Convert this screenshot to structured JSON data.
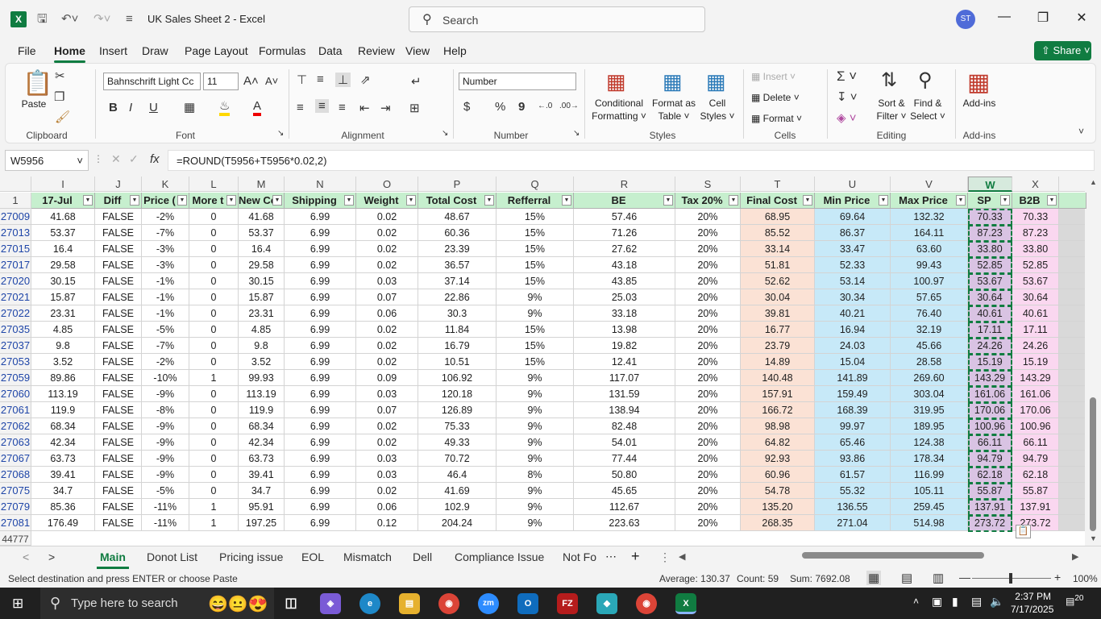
{
  "window": {
    "title": "UK Sales Sheet 2  -  Excel",
    "app_icon": "X",
    "avatar": "ST",
    "search_placeholder": "Search"
  },
  "menu": {
    "items": [
      "File",
      "Home",
      "Insert",
      "Draw",
      "Page Layout",
      "Formulas",
      "Data",
      "Review",
      "View",
      "Help"
    ],
    "active": "Home",
    "share": "Share"
  },
  "ribbon": {
    "clipboard": {
      "paste": "Paste",
      "label": "Clipboard"
    },
    "font": {
      "name": "Bahnschrift Light Cc",
      "size": "11",
      "bold": "B",
      "italic": "I",
      "underline": "U",
      "label": "Font"
    },
    "alignment": {
      "label": "Alignment"
    },
    "number": {
      "format": "Number",
      "currency": "$",
      "percent": "%",
      "comma": "9",
      "label": "Number"
    },
    "styles": {
      "conditional": "Conditional",
      "conditional2": "Formatting",
      "format_table": "Format as",
      "format_table2": "Table",
      "cell_styles": "Cell",
      "cell_styles2": "Styles",
      "label": "Styles"
    },
    "cells": {
      "insert": "Insert",
      "delete": "Delete",
      "format": "Format",
      "label": "Cells"
    },
    "editing": {
      "sort": "Sort &",
      "sort2": "Filter",
      "find": "Find &",
      "find2": "Select",
      "label": "Editing"
    },
    "addins": {
      "addins": "Add-ins",
      "label": "Add-ins"
    }
  },
  "formula_bar": {
    "name_box": "W5956",
    "fx": "fx",
    "formula": "=ROUND(T5956+T5956*0.02,2)"
  },
  "columns": [
    "I",
    "J",
    "K",
    "L",
    "M",
    "N",
    "O",
    "P",
    "Q",
    "R",
    "S",
    "T",
    "U",
    "V",
    "W",
    "X"
  ],
  "headers": [
    "17-Jul",
    "Diff",
    "Price (",
    "More t",
    "New Cc",
    "Shipping",
    "Weight",
    "Total Cost",
    "Refferral",
    "BE",
    "Tax 20%",
    "Final Cost",
    "Min Price",
    "Max Price",
    "SP",
    "B2B"
  ],
  "row1_label": "1",
  "rows": [
    {
      "r": "27009",
      "v": [
        "41.68",
        "FALSE",
        "-2%",
        "0",
        "41.68",
        "6.99",
        "0.02",
        "48.67",
        "15%",
        "57.46",
        "20%",
        "68.95",
        "69.64",
        "132.32",
        "70.33",
        "70.33"
      ]
    },
    {
      "r": "27013",
      "v": [
        "53.37",
        "FALSE",
        "-7%",
        "0",
        "53.37",
        "6.99",
        "0.02",
        "60.36",
        "15%",
        "71.26",
        "20%",
        "85.52",
        "86.37",
        "164.11",
        "87.23",
        "87.23"
      ]
    },
    {
      "r": "27015",
      "v": [
        "16.4",
        "FALSE",
        "-3%",
        "0",
        "16.4",
        "6.99",
        "0.02",
        "23.39",
        "15%",
        "27.62",
        "20%",
        "33.14",
        "33.47",
        "63.60",
        "33.80",
        "33.80"
      ]
    },
    {
      "r": "27017",
      "v": [
        "29.58",
        "FALSE",
        "-3%",
        "0",
        "29.58",
        "6.99",
        "0.02",
        "36.57",
        "15%",
        "43.18",
        "20%",
        "51.81",
        "52.33",
        "99.43",
        "52.85",
        "52.85"
      ]
    },
    {
      "r": "27020",
      "v": [
        "30.15",
        "FALSE",
        "-1%",
        "0",
        "30.15",
        "6.99",
        "0.03",
        "37.14",
        "15%",
        "43.85",
        "20%",
        "52.62",
        "53.14",
        "100.97",
        "53.67",
        "53.67"
      ]
    },
    {
      "r": "27021",
      "v": [
        "15.87",
        "FALSE",
        "-1%",
        "0",
        "15.87",
        "6.99",
        "0.07",
        "22.86",
        "9%",
        "25.03",
        "20%",
        "30.04",
        "30.34",
        "57.65",
        "30.64",
        "30.64"
      ]
    },
    {
      "r": "27022",
      "v": [
        "23.31",
        "FALSE",
        "-1%",
        "0",
        "23.31",
        "6.99",
        "0.06",
        "30.3",
        "9%",
        "33.18",
        "20%",
        "39.81",
        "40.21",
        "76.40",
        "40.61",
        "40.61"
      ]
    },
    {
      "r": "27035",
      "v": [
        "4.85",
        "FALSE",
        "-5%",
        "0",
        "4.85",
        "6.99",
        "0.02",
        "11.84",
        "15%",
        "13.98",
        "20%",
        "16.77",
        "16.94",
        "32.19",
        "17.11",
        "17.11"
      ]
    },
    {
      "r": "27037",
      "v": [
        "9.8",
        "FALSE",
        "-7%",
        "0",
        "9.8",
        "6.99",
        "0.02",
        "16.79",
        "15%",
        "19.82",
        "20%",
        "23.79",
        "24.03",
        "45.66",
        "24.26",
        "24.26"
      ]
    },
    {
      "r": "27053",
      "v": [
        "3.52",
        "FALSE",
        "-2%",
        "0",
        "3.52",
        "6.99",
        "0.02",
        "10.51",
        "15%",
        "12.41",
        "20%",
        "14.89",
        "15.04",
        "28.58",
        "15.19",
        "15.19"
      ]
    },
    {
      "r": "27059",
      "v": [
        "89.86",
        "FALSE",
        "-10%",
        "1",
        "99.93",
        "6.99",
        "0.09",
        "106.92",
        "9%",
        "117.07",
        "20%",
        "140.48",
        "141.89",
        "269.60",
        "143.29",
        "143.29"
      ]
    },
    {
      "r": "27060",
      "v": [
        "113.19",
        "FALSE",
        "-9%",
        "0",
        "113.19",
        "6.99",
        "0.03",
        "120.18",
        "9%",
        "131.59",
        "20%",
        "157.91",
        "159.49",
        "303.04",
        "161.06",
        "161.06"
      ]
    },
    {
      "r": "27061",
      "v": [
        "119.9",
        "FALSE",
        "-8%",
        "0",
        "119.9",
        "6.99",
        "0.07",
        "126.89",
        "9%",
        "138.94",
        "20%",
        "166.72",
        "168.39",
        "319.95",
        "170.06",
        "170.06"
      ]
    },
    {
      "r": "27062",
      "v": [
        "68.34",
        "FALSE",
        "-9%",
        "0",
        "68.34",
        "6.99",
        "0.02",
        "75.33",
        "9%",
        "82.48",
        "20%",
        "98.98",
        "99.97",
        "189.95",
        "100.96",
        "100.96"
      ]
    },
    {
      "r": "27063",
      "v": [
        "42.34",
        "FALSE",
        "-9%",
        "0",
        "42.34",
        "6.99",
        "0.02",
        "49.33",
        "9%",
        "54.01",
        "20%",
        "64.82",
        "65.46",
        "124.38",
        "66.11",
        "66.11"
      ]
    },
    {
      "r": "27067",
      "v": [
        "63.73",
        "FALSE",
        "-9%",
        "0",
        "63.73",
        "6.99",
        "0.03",
        "70.72",
        "9%",
        "77.44",
        "20%",
        "92.93",
        "93.86",
        "178.34",
        "94.79",
        "94.79"
      ]
    },
    {
      "r": "27068",
      "v": [
        "39.41",
        "FALSE",
        "-9%",
        "0",
        "39.41",
        "6.99",
        "0.03",
        "46.4",
        "8%",
        "50.80",
        "20%",
        "60.96",
        "61.57",
        "116.99",
        "62.18",
        "62.18"
      ]
    },
    {
      "r": "27075",
      "v": [
        "34.7",
        "FALSE",
        "-5%",
        "0",
        "34.7",
        "6.99",
        "0.02",
        "41.69",
        "9%",
        "45.65",
        "20%",
        "54.78",
        "55.32",
        "105.11",
        "55.87",
        "55.87"
      ]
    },
    {
      "r": "27079",
      "v": [
        "85.36",
        "FALSE",
        "-11%",
        "1",
        "95.91",
        "6.99",
        "0.06",
        "102.9",
        "9%",
        "112.67",
        "20%",
        "135.20",
        "136.55",
        "259.45",
        "137.91",
        "137.91"
      ]
    },
    {
      "r": "27081",
      "v": [
        "176.49",
        "FALSE",
        "-11%",
        "1",
        "197.25",
        "6.99",
        "0.12",
        "204.24",
        "9%",
        "223.63",
        "20%",
        "268.35",
        "271.04",
        "514.98",
        "273.72",
        "273.72"
      ]
    }
  ],
  "last_row": "44777",
  "sheet_tabs": [
    "Main",
    "Donot List",
    "Pricing issue",
    "EOL",
    "Mismatch",
    "Dell",
    "Compliance Issue",
    "Not Fo"
  ],
  "active_sheet": "Main",
  "status": {
    "message": "Select destination and press ENTER or choose Paste",
    "average": "Average: 130.37",
    "count": "Count: 59",
    "sum": "Sum: 7692.08",
    "zoom": "100%"
  },
  "taskbar": {
    "search": "Type here to search",
    "time": "2:37 PM",
    "date": "7/17/2025",
    "notifications": "20"
  },
  "colors": {
    "accent": "#107c41",
    "final_cost": "#fbe2d5",
    "price_blue": "#c7e9f8",
    "sp_purple": "#d9c3e3",
    "b2b_pink": "#fad7f0",
    "header_green": "#c6efce"
  }
}
